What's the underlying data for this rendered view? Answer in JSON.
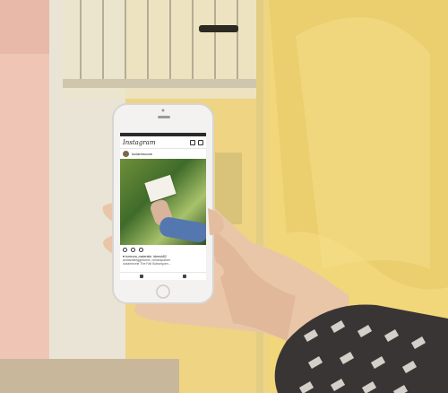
{
  "instagram": {
    "logo": "Instagram",
    "username": "luciamiscone",
    "likes": "♥ torrezza_materiale, lcleeok82",
    "caption": "andiameleggeltome, richardparker",
    "caption2": "luciaimcnne The Fall Subsequen..."
  },
  "icons": {
    "header": [
      "add-user-icon",
      "inbox-icon"
    ],
    "actions": [
      "heart-icon",
      "comment-icon",
      "share-icon"
    ],
    "tabs": [
      "home-icon",
      "search-icon"
    ]
  }
}
